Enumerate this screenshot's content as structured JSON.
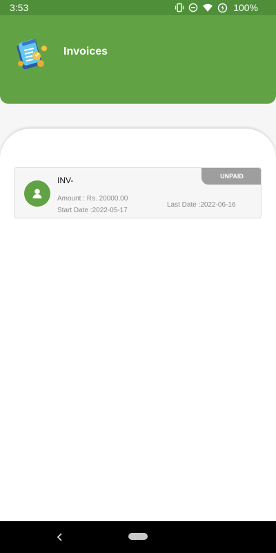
{
  "status_bar": {
    "time": "3:53",
    "battery": "100%",
    "icons": [
      "vibrate-icon",
      "do-not-disturb-icon",
      "wifi-icon",
      "battery-saver-icon"
    ]
  },
  "header": {
    "title": "Invoices",
    "logo_icon": "invoice-logo-icon",
    "background_color": "#61a344"
  },
  "invoice": {
    "number": "INV-",
    "amount": "Amount : Rs. 20000.00",
    "start_date": "Start Date :2022-05-17",
    "last_date": "Last Date :2022-06-16",
    "status": "UNPAID",
    "avatar_icon": "user-icon"
  },
  "navigation": {
    "back_icon": "back-chevron-icon",
    "home_icon": "home-pill-icon"
  }
}
